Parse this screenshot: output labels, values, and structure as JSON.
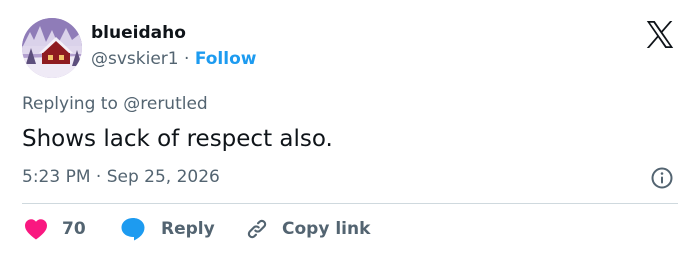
{
  "author": {
    "display_name": "blueidaho",
    "handle": "@svskier1",
    "separator": "·",
    "follow_label": "Follow"
  },
  "reply_context": "Replying to @rerutled",
  "tweet": {
    "text": "Shows lack of respect also.",
    "timestamp": "5:23 PM · Sep 25, 2026"
  },
  "actions": {
    "like_count": "70",
    "reply_label": "Reply",
    "copy_label": "Copy link"
  },
  "icons": {
    "logo": "x-logo-icon",
    "info": "info-icon",
    "like": "heart-icon",
    "reply": "speech-bubble-icon",
    "copy": "link-icon"
  },
  "colors": {
    "accent": "#1d9bf0",
    "like": "#f91880",
    "text": "#0f1419",
    "muted": "#536471",
    "divider": "#cfd9de"
  }
}
